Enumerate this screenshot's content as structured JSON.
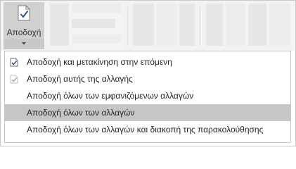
{
  "ribbon": {
    "accept_button": {
      "label": "Αποδοχή",
      "icon": "document-checkmark-icon"
    }
  },
  "menu": {
    "items": [
      {
        "label": "Αποδοχή και μετακίνηση στην επόμενη",
        "icon": "accept-move-next-icon",
        "highlighted": false
      },
      {
        "label": "Αποδοχή αυτής της αλλαγής",
        "icon": "accept-change-icon",
        "highlighted": false,
        "icon_dimmed": true
      },
      {
        "label": "Αποδοχή όλων των εμφανιζόμενων αλλαγών",
        "highlighted": false
      },
      {
        "label": "Αποδοχή όλων των αλλαγών",
        "highlighted": true
      },
      {
        "label": "Αποδοχή όλων των αλλαγών και διακοπή της παρακολούθησης",
        "highlighted": false
      }
    ]
  },
  "colors": {
    "accent": "#2b579a",
    "highlight": "#c6c6c6",
    "ribbon_bg": "#f3f3f3"
  }
}
